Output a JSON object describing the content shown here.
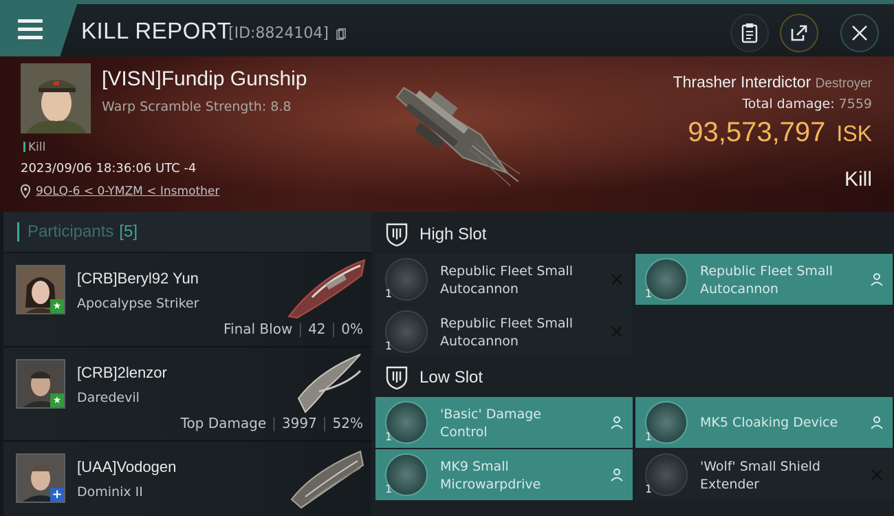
{
  "header": {
    "title": "KILL REPORT",
    "report_id": "[ID:8824104]"
  },
  "victim": {
    "name": "[VISN]Fundip Gunship",
    "subtitle": "Warp Scramble Strength: 8.8",
    "tag": "Kill",
    "timestamp": "2023/09/06 18:36:06 UTC -4",
    "location": "9OLQ-6 < 0-YMZM < Insmother",
    "ship": "Thrasher Interdictor",
    "ship_class": "Destroyer",
    "total_damage_label": "Total damage:",
    "total_damage": "7559",
    "isk_value": "93,573,797",
    "isk_unit": "ISK",
    "result": "Kill"
  },
  "participants": {
    "label": "Participants",
    "count": "[5]",
    "items": [
      {
        "name": "[CRB]Beryl92 Yun",
        "ship": "Apocalypse Striker",
        "role": "Final Blow",
        "damage": "42",
        "percent": "0%"
      },
      {
        "name": "[CRB]2lenzor",
        "ship": "Daredevil",
        "role": "Top Damage",
        "damage": "3997",
        "percent": "52%"
      },
      {
        "name": "[UAA]Vodogen",
        "ship": "Dominix II"
      }
    ]
  },
  "fittings": {
    "high_slot_label": "High Slot",
    "low_slot_label": "Low Slot",
    "high": [
      {
        "qty": "1",
        "name_line1": "Republic Fleet Small",
        "name_line2": "Autocannon",
        "status": "destroyed"
      },
      {
        "qty": "1",
        "name_line1": "Republic Fleet Small",
        "name_line2": "Autocannon",
        "status": "dropped"
      },
      {
        "qty": "1",
        "name_line1": "Republic Fleet Small",
        "name_line2": "Autocannon",
        "status": "destroyed"
      }
    ],
    "low": [
      {
        "qty": "1",
        "name_line1": "'Basic' Damage",
        "name_line2": "Control",
        "status": "dropped"
      },
      {
        "qty": "1",
        "name_line1": "MK5 Cloaking Device",
        "name_line2": "",
        "status": "dropped"
      },
      {
        "qty": "1",
        "name_line1": "MK9 Small",
        "name_line2": "Microwarpdrive",
        "status": "dropped"
      },
      {
        "qty": "1",
        "name_line1": "'Wolf' Small Shield",
        "name_line2": "Extender",
        "status": "destroyed"
      }
    ]
  },
  "colors": {
    "accent": "#3fa59a",
    "isk": "#f2b65a",
    "fitted_bg": "#3a8a82"
  }
}
